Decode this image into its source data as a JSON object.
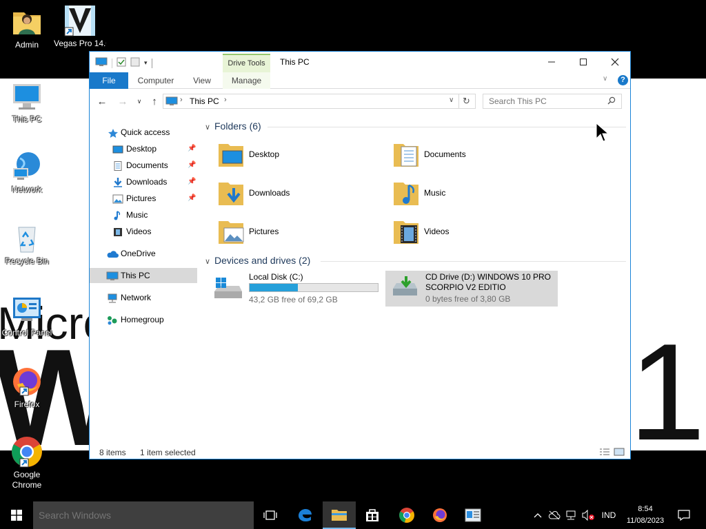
{
  "desktop": {
    "wallpaper_texts": [
      "Micro",
      "W",
      "1"
    ],
    "icons": [
      {
        "label": "Admin"
      },
      {
        "label": "Vegas Pro 14.0 (64-"
      },
      {
        "label": "This PC"
      },
      {
        "label": "Network"
      },
      {
        "label": "Recycle Bin"
      },
      {
        "label": "Control Panel"
      },
      {
        "label": "Firefox"
      },
      {
        "label": "Google Chrome"
      }
    ]
  },
  "window": {
    "title": "This PC",
    "contextual_tab": "Drive Tools",
    "ribbon_tabs": [
      "File",
      "Computer",
      "View",
      "Manage"
    ],
    "address_crumb": "This PC",
    "search_placeholder": "Search This PC",
    "navpane": {
      "items": [
        {
          "label": "Quick access",
          "icon": "star-icon"
        },
        {
          "label": "Desktop",
          "icon": "desktop-icon",
          "pinned": true
        },
        {
          "label": "Documents",
          "icon": "document-icon",
          "pinned": true
        },
        {
          "label": "Downloads",
          "icon": "download-arrow-icon",
          "pinned": true
        },
        {
          "label": "Pictures",
          "icon": "pictures-icon",
          "pinned": true
        },
        {
          "label": "Music",
          "icon": "music-icon"
        },
        {
          "label": "Videos",
          "icon": "videos-icon"
        },
        {
          "label": "OneDrive",
          "icon": "cloud-icon"
        },
        {
          "label": "This PC",
          "icon": "computer-icon",
          "selected": true
        },
        {
          "label": "Network",
          "icon": "network-icon"
        },
        {
          "label": "Homegroup",
          "icon": "homegroup-icon"
        }
      ]
    },
    "folders_header": "Folders (6)",
    "folders": [
      {
        "name": "Desktop"
      },
      {
        "name": "Documents"
      },
      {
        "name": "Downloads"
      },
      {
        "name": "Music"
      },
      {
        "name": "Pictures"
      },
      {
        "name": "Videos"
      }
    ],
    "devices_header": "Devices and drives (2)",
    "drives": [
      {
        "name": "Local Disk (C:)",
        "free_text": "43,2 GB free of 69,2 GB",
        "used_fraction": 0.376
      },
      {
        "name_line1": "CD Drive (D:) WINDOWS 10 PRO",
        "name_line2": "SCORPIO V2 EDITIO",
        "free_text": "0 bytes free of 3,80 GB"
      }
    ],
    "status": {
      "count": "8 items",
      "selection": "1 item selected"
    }
  },
  "taskbar": {
    "search_placeholder": "Search Windows",
    "language": "IND",
    "time": "8:54",
    "date": "11/08/2023"
  }
}
